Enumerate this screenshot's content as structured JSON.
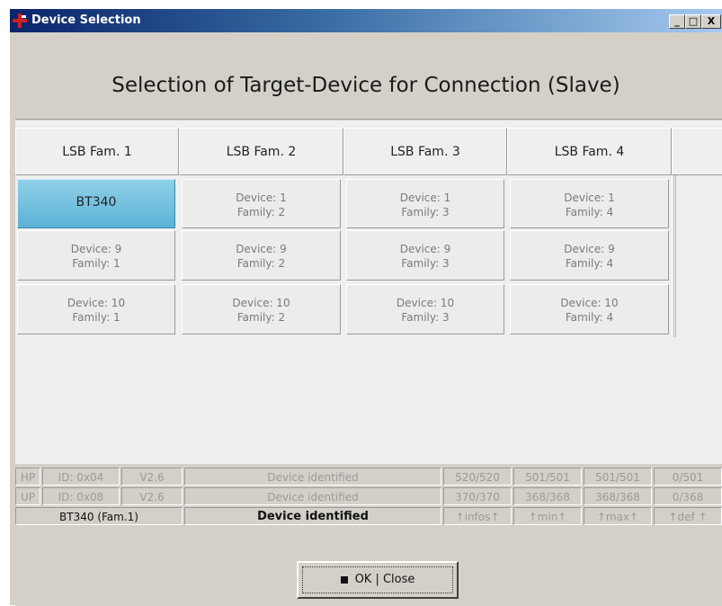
{
  "window": {
    "title": "Device Selection",
    "min": "_",
    "max": "□",
    "close": "X"
  },
  "heading": "Selection of Target-Device for Connection (Slave)",
  "tabs": [
    "LSB Fam. 1",
    "LSB Fam. 2",
    "LSB Fam. 3",
    "LSB Fam. 4"
  ],
  "devices": {
    "selected": "BT340",
    "col1": [
      [
        "Device: 9",
        "Family: 1"
      ],
      [
        "Device: 10",
        "Family: 1"
      ]
    ],
    "col2": [
      [
        "Device: 1",
        "Family: 2"
      ],
      [
        "Device: 9",
        "Family: 2"
      ],
      [
        "Device: 10",
        "Family: 2"
      ]
    ],
    "col3": [
      [
        "Device: 1",
        "Family: 3"
      ],
      [
        "Device: 9",
        "Family: 3"
      ],
      [
        "Device: 10",
        "Family: 3"
      ]
    ],
    "col4": [
      [
        "Device: 1",
        "Family: 4"
      ],
      [
        "Device: 9",
        "Family: 4"
      ],
      [
        "Device: 10",
        "Family: 4"
      ]
    ]
  },
  "status": {
    "row_hp": [
      "HP",
      "ID: 0x04",
      "V2.6",
      "Device identified",
      "520/520",
      "501/501",
      "501/501",
      "0/501"
    ],
    "row_up": [
      "UP",
      "ID: 0x08",
      "V2.6",
      "Device identified",
      "370/370",
      "368/368",
      "368/368",
      "0/368"
    ],
    "row_main": [
      "BT340 (Fam.1)",
      "Device identified",
      "↑infos↑",
      "↑min↑",
      "↑max↑",
      "↑def ↑"
    ]
  },
  "ok_button": "OK | Close",
  "colors": {
    "title_start": "#0a246a",
    "title_end": "#a6caf0",
    "selected_device": "#5bb2d6"
  }
}
